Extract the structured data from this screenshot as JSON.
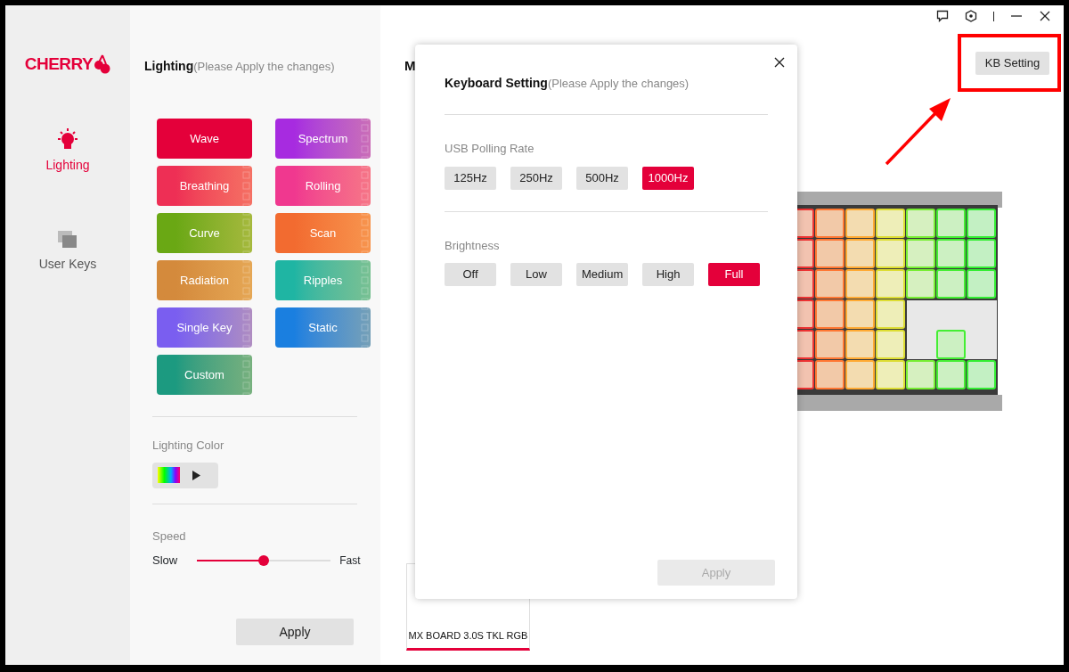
{
  "sidebar": {
    "logo": "CHERRY",
    "items": [
      {
        "label": "Lighting",
        "selected": true,
        "kind": "bulb"
      },
      {
        "label": "User Keys",
        "selected": false,
        "kind": "layers"
      }
    ]
  },
  "lighting": {
    "title": "Lighting",
    "hint": "(Please Apply the changes)",
    "effects": [
      {
        "label": "Wave",
        "color": "#e4003a",
        "selected": true
      },
      {
        "label": "Spectrum",
        "color": "#a72be0",
        "selected": false
      },
      {
        "label": "Breathing",
        "color": "#ee2f55",
        "selected": false
      },
      {
        "label": "Rolling",
        "color": "#f0388f",
        "selected": false
      },
      {
        "label": "Curve",
        "color": "#6aa814",
        "selected": false
      },
      {
        "label": "Scan",
        "color": "#f26b30",
        "selected": false
      },
      {
        "label": "Radiation",
        "color": "#d48a3c",
        "selected": false
      },
      {
        "label": "Ripples",
        "color": "#1fb5a3",
        "selected": false
      },
      {
        "label": "Single Key",
        "color": "#7a5ef0",
        "selected": false
      },
      {
        "label": "Static",
        "color": "#1a7fe0",
        "selected": false
      },
      {
        "label": "Custom",
        "color": "#1c9a80",
        "selected": false
      }
    ],
    "color_label": "Lighting Color",
    "speed_label": "Speed",
    "speed_min": "Slow",
    "speed_max": "Fast",
    "speed": {
      "level": 0.5
    },
    "apply": "Apply"
  },
  "main": {
    "title": "M",
    "kb_setting": "KB Setting",
    "device": "MX BOARD 3.0S TKL RGB",
    "device_selected": true
  },
  "dialog": {
    "title": "Keyboard Setting",
    "hint": "(Please Apply the changes)",
    "polling_label": "USB Polling Rate",
    "polling": [
      {
        "label": "125Hz",
        "selected": false
      },
      {
        "label": "250Hz",
        "selected": false
      },
      {
        "label": "500Hz",
        "selected": false
      },
      {
        "label": "1000Hz",
        "selected": true
      }
    ],
    "brightness_label": "Brightness",
    "brightness": [
      {
        "label": "Off",
        "selected": false
      },
      {
        "label": "Low",
        "selected": false
      },
      {
        "label": "Medium",
        "selected": false
      },
      {
        "label": "High",
        "selected": false
      },
      {
        "label": "Full",
        "selected": true
      }
    ],
    "apply": "Apply",
    "apply_disabled": true
  }
}
